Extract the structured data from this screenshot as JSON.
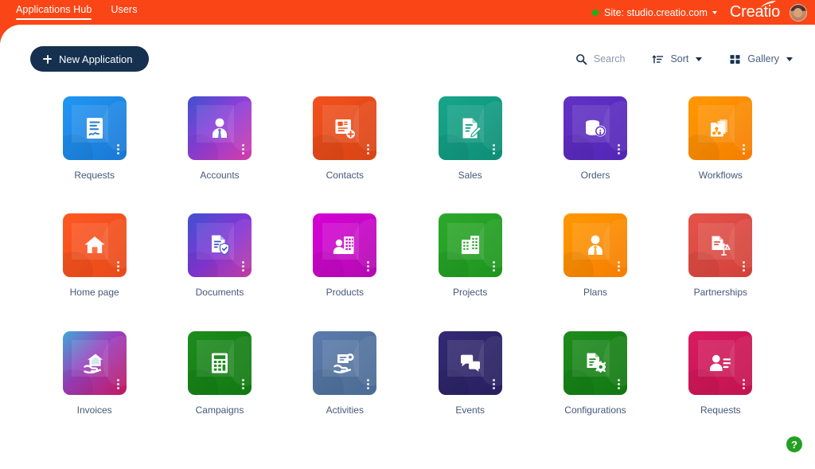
{
  "header": {
    "tabs": [
      {
        "label": "Applications Hub",
        "active": true
      },
      {
        "label": "Users",
        "active": false
      }
    ],
    "site": {
      "label": "Site: studio.creatio.com",
      "status_color": "#19b319"
    },
    "brand": "Creatio",
    "avatar_name": "user-avatar"
  },
  "toolbar": {
    "new_application_label": "New Application",
    "search_label": "Search",
    "sort_label": "Sort",
    "gallery_label": "Gallery"
  },
  "help": {
    "label": "?"
  },
  "colors": {
    "brand_orange": "#FA4616",
    "dark_navy": "#16304f",
    "label_text": "#46587a",
    "help_green": "#23a022"
  },
  "apps": [
    {
      "name": "Requests",
      "icon": "document-signature-icon",
      "gradient": "linear-gradient(135deg,#2196F3 0%,#1E88E5 50%,#1976D2 100%)"
    },
    {
      "name": "Accounts",
      "icon": "person-tie-icon",
      "gradient": "linear-gradient(135deg,#3F51CF 0%,#8E3FD8 48%,#D63BA8 100%)"
    },
    {
      "name": "Contacts",
      "icon": "contact-add-icon",
      "gradient": "linear-gradient(135deg,#F4511E 0%,#E64A19 50%,#D84315 100%)"
    },
    {
      "name": "Sales",
      "icon": "document-edit-icon",
      "gradient": "linear-gradient(135deg,#17A589 0%,#129B82 50%,#0E8C74 100%)"
    },
    {
      "name": "Orders",
      "icon": "coins-info-icon",
      "gradient": "linear-gradient(135deg,#6232C4 0%,#5B2CBF 50%,#5325B5 100%)"
    },
    {
      "name": "Workflows",
      "icon": "folder-flow-icon",
      "gradient": "linear-gradient(135deg,#FF9800 0%,#FB8C00 50%,#F57C00 100%)"
    },
    {
      "name": "Home page",
      "icon": "house-icon",
      "gradient": "linear-gradient(135deg,#FF5722 0%,#F4511E 50%,#E64A19 100%)"
    },
    {
      "name": "Documents",
      "icon": "document-shield-icon",
      "gradient": "linear-gradient(135deg,#3F51CF 0%,#8336D6 52%,#C23C9E 100%)"
    },
    {
      "name": "Products",
      "icon": "person-building-icon",
      "gradient": "linear-gradient(135deg,#D500D5 0%,#C707C7 50%,#B00BAE 100%)"
    },
    {
      "name": "Projects",
      "icon": "building-icon",
      "gradient": "linear-gradient(135deg,#2DA82D 0%,#24A024 50%,#1E941E 100%)"
    },
    {
      "name": "Plans",
      "icon": "person-tie-icon",
      "gradient": "linear-gradient(135deg,#FF9800 0%,#FB8C00 50%,#F57C00 100%)"
    },
    {
      "name": "Partnerships",
      "icon": "document-scales-icon",
      "gradient": "linear-gradient(135deg,#E4524A 0%,#DC4A42 50%,#D2423A 100%)"
    },
    {
      "name": "Invoices",
      "icon": "hand-house-icon",
      "gradient": "linear-gradient(135deg,#3DA8D8 0%,#9B3FBE 45%,#C2185B 100%)"
    },
    {
      "name": "Campaigns",
      "icon": "calculator-icon",
      "gradient": "linear-gradient(135deg,#1E8C1E 0%,#178217 50%,#127812 100%)"
    },
    {
      "name": "Activities",
      "icon": "hand-gear-icon",
      "gradient": "linear-gradient(135deg,#5B7BAE 0%,#53739F 50%,#4B6B93 100%)"
    },
    {
      "name": "Events",
      "icon": "chat-bubbles-icon",
      "gradient": "linear-gradient(135deg,#332A74 0%,#2D2569 50%,#271F5E 100%)"
    },
    {
      "name": "Configurations",
      "icon": "document-gear-icon",
      "gradient": "linear-gradient(135deg,#1E8C1E 0%,#178217 50%,#127812 100%)"
    },
    {
      "name": "Requests",
      "icon": "contact-card-icon",
      "gradient": "linear-gradient(135deg,#D81B60 0%,#CE1757 50%,#C2134F 100%)"
    }
  ]
}
